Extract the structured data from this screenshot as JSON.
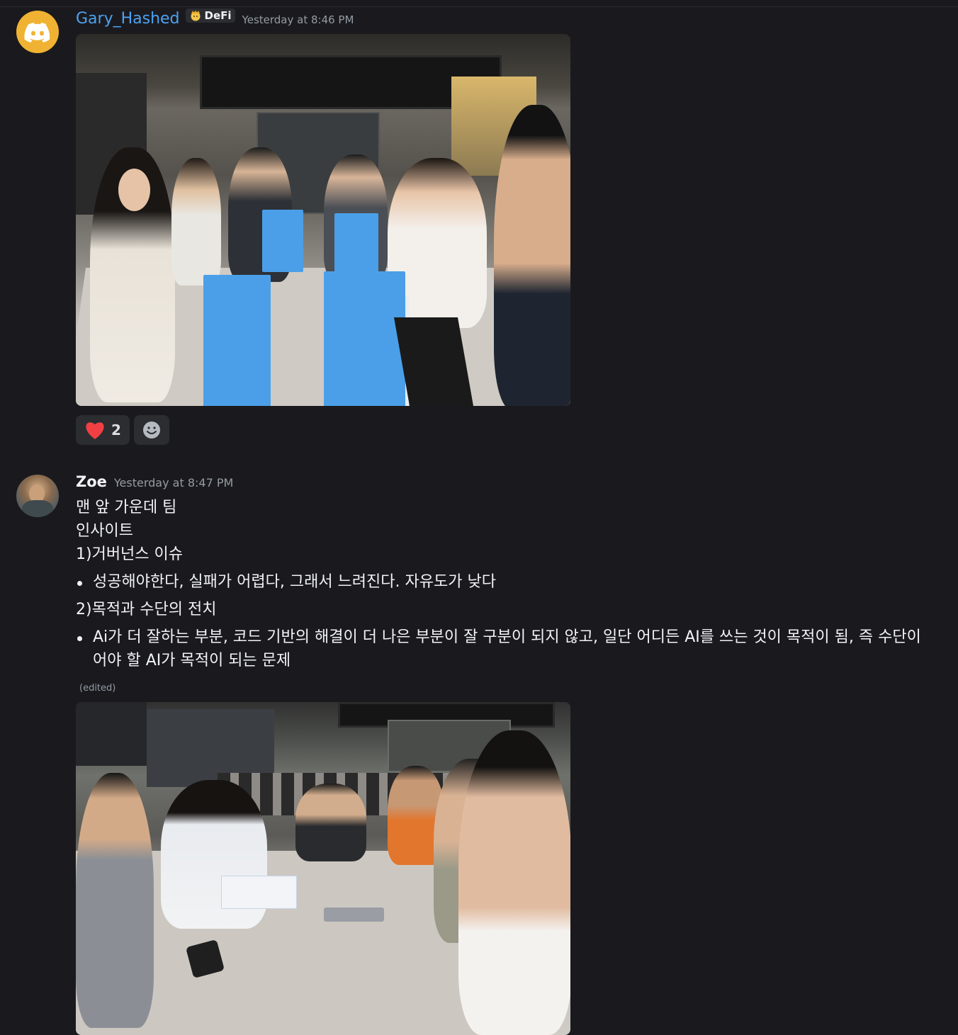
{
  "messages": [
    {
      "author": "Gary_Hashed",
      "tag": "DeFi",
      "timestamp": "Yesterday at 8:46 PM",
      "avatar_icon": "discord-logo-icon",
      "attachment": "group-photo-icon",
      "reactions": [
        {
          "emoji": "heart-icon",
          "count": "2"
        },
        {
          "emoji": "add-reaction-icon",
          "count": ""
        }
      ]
    },
    {
      "author": "Zoe",
      "timestamp": "Yesterday at 8:47 PM",
      "lines": {
        "l1": "맨 앞 가운데 팀",
        "l2": "인사이트",
        "l3": "1)거버넌스 이슈",
        "b1": "성공해야한다, 실패가 어렵다, 그래서 느려진다. 자유도가 낮다",
        "l4": "2)목적과 수단의 전치",
        "b2": "Ai가 더 잘하는 부분, 코드 기반의 해결이 더 나은 부분이 잘 구분이 되지 않고, 일단 어디든 AI를 쓰는 것이 목적이 됨, 즉 수단이 어야 할 AI가 목적이 되는 문제"
      },
      "edited": "(edited)",
      "attachment": "group-photo-icon"
    }
  ],
  "colors": {
    "background": "#1a1a1e",
    "username_gary": "#4ea1f0",
    "avatar_discord": "#f0b232",
    "heart": "#f23f43"
  }
}
